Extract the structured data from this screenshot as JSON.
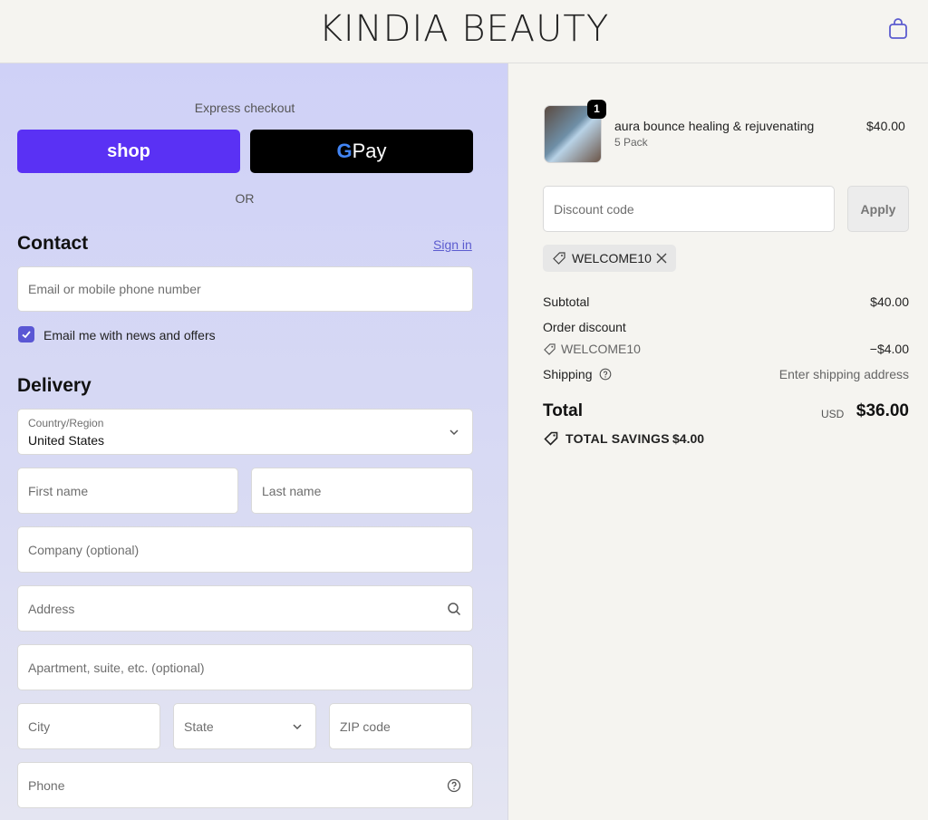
{
  "header": {
    "brand": "KINDIA BEAUTY",
    "cart_icon": "shopping-bag-icon"
  },
  "express": {
    "label": "Express checkout",
    "shop_label": "shop",
    "gpay_label": "Pay",
    "gpay_g": "G",
    "or_label": "OR"
  },
  "contact": {
    "title": "Contact",
    "signin": "Sign in",
    "email_placeholder": "Email or mobile phone number",
    "newsletter_label": "Email me with news and offers",
    "newsletter_checked": true
  },
  "delivery": {
    "title": "Delivery",
    "country_label": "Country/Region",
    "country_value": "United States",
    "first_name_placeholder": "First name",
    "last_name_placeholder": "Last name",
    "company_placeholder": "Company (optional)",
    "address_placeholder": "Address",
    "apartment_placeholder": "Apartment, suite, etc. (optional)",
    "city_placeholder": "City",
    "state_placeholder": "State",
    "zip_placeholder": "ZIP code",
    "phone_placeholder": "Phone"
  },
  "summary": {
    "product": {
      "quantity": "1",
      "name": "aura bounce healing & rejuvenating",
      "variant": "5 Pack",
      "price": "$40.00"
    },
    "discount_placeholder": "Discount code",
    "apply_label": "Apply",
    "applied_code": "WELCOME10",
    "subtotal_label": "Subtotal",
    "subtotal_value": "$40.00",
    "order_discount_label": "Order discount",
    "order_discount_code": "WELCOME10",
    "order_discount_value": "−$4.00",
    "shipping_label": "Shipping",
    "shipping_value": "Enter shipping address",
    "total_label": "Total",
    "currency": "USD",
    "total_value": "$36.00",
    "savings_label": "TOTAL SAVINGS",
    "savings_value": "$4.00"
  },
  "colors": {
    "shop_purple": "#5a31f4",
    "checkbox": "#5a57d4",
    "link": "#5c5ccf"
  }
}
